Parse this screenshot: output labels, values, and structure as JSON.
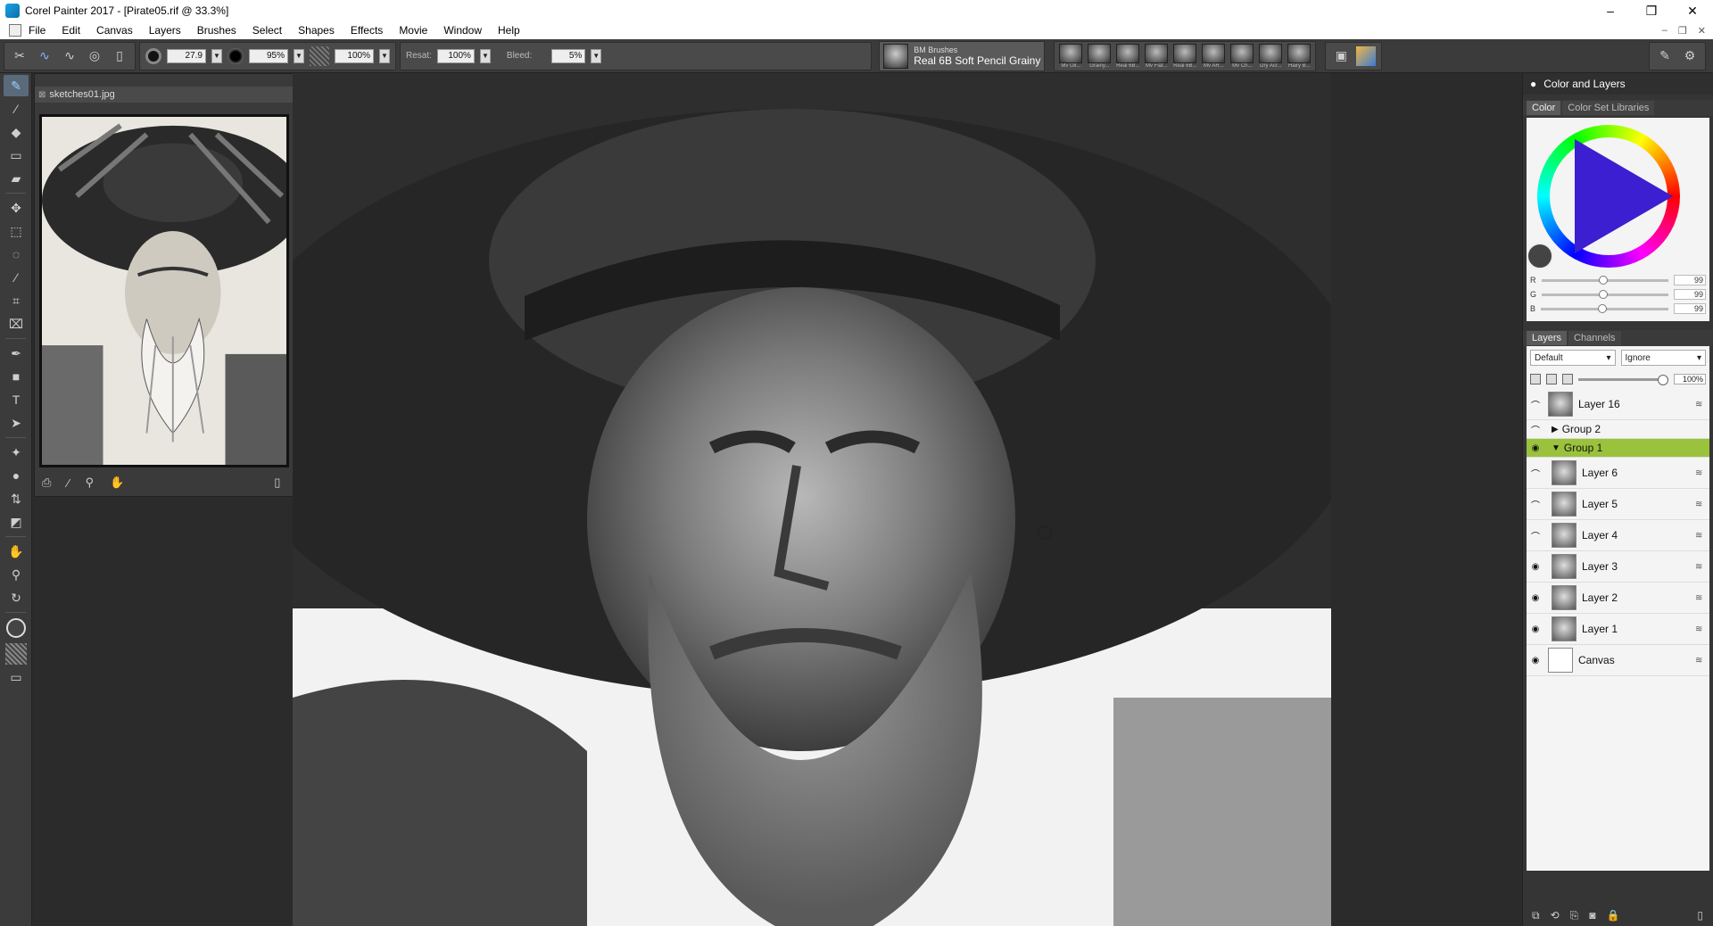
{
  "window": {
    "title": "Corel Painter 2017 - [Pirate05.rif @ 33.3%]",
    "controls": [
      "–",
      "❐",
      "✕"
    ],
    "doc_controls": [
      "–",
      "❐",
      "✕"
    ]
  },
  "menu": {
    "items": [
      "File",
      "Edit",
      "Canvas",
      "Layers",
      "Brushes",
      "Select",
      "Shapes",
      "Effects",
      "Movie",
      "Window",
      "Help"
    ]
  },
  "properties": {
    "size": "27.9",
    "opacity": "95%",
    "grain": "100%",
    "resat_label": "Resat:",
    "resat": "100%",
    "bleed_label": "Bleed:",
    "bleed": "5%"
  },
  "brush_selector": {
    "category": "BM Brushes",
    "variant": "Real 6B Soft Pencil Grainy"
  },
  "recent_brushes": [
    "Mv Oil...",
    "Grainy...",
    "Real 6B...",
    "Mv Flat...",
    "Real 6B...",
    "Mv AR...",
    "Mv Ch...",
    "Dry Acr...",
    "Hairy B..."
  ],
  "navigator": {
    "tab_label": "sketches01.jpg"
  },
  "right_panel": {
    "header": "Color and Layers",
    "color_tabs": [
      "Color",
      "Color Set Libraries"
    ],
    "rgb": [
      {
        "label": "R",
        "value": "99"
      },
      {
        "label": "G",
        "value": "99"
      },
      {
        "label": "B",
        "value": "99"
      }
    ],
    "current_color": "#636363",
    "layer_tabs": [
      "Layers",
      "Channels"
    ],
    "composite_method": "Default",
    "composite_depth": "Ignore",
    "opacity": "100%",
    "layers": [
      {
        "name": "Layer 16",
        "kind": "layer",
        "visible": false,
        "selected": false
      },
      {
        "name": "Group 2",
        "kind": "group-collapsed",
        "visible": false,
        "selected": false
      },
      {
        "name": "Group 1",
        "kind": "group-expanded",
        "visible": true,
        "selected": true
      },
      {
        "name": "Layer 6",
        "kind": "layer",
        "visible": false,
        "selected": false
      },
      {
        "name": "Layer 5",
        "kind": "layer",
        "visible": false,
        "selected": false
      },
      {
        "name": "Layer 4",
        "kind": "layer",
        "visible": false,
        "selected": false
      },
      {
        "name": "Layer 3",
        "kind": "layer",
        "visible": true,
        "selected": false
      },
      {
        "name": "Layer 2",
        "kind": "layer",
        "visible": true,
        "selected": false
      },
      {
        "name": "Layer 1",
        "kind": "layer",
        "visible": true,
        "selected": false
      },
      {
        "name": "Canvas",
        "kind": "canvas",
        "visible": true,
        "selected": false
      }
    ]
  },
  "colors": {
    "selected_layer": "#9ac23c",
    "ui_dark": "#3b3b3b"
  }
}
